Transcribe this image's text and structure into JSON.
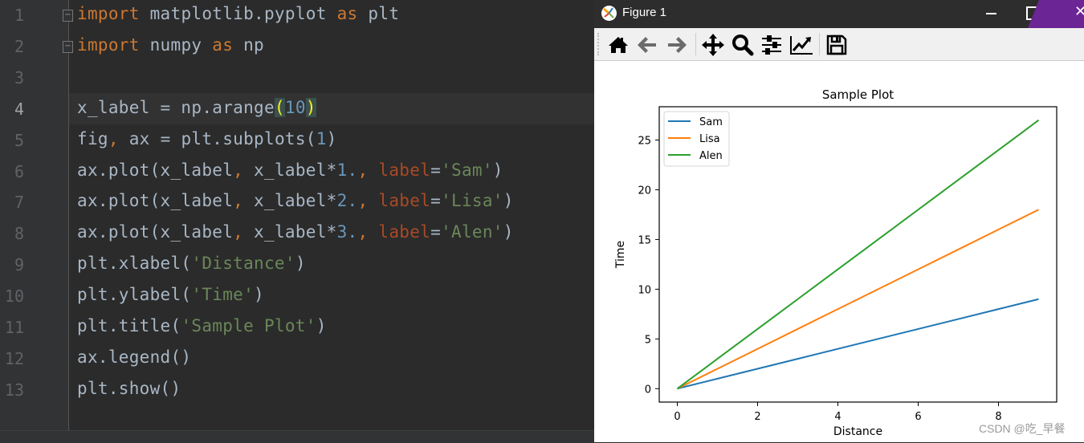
{
  "editor": {
    "lines": [
      {
        "num": "1",
        "tokens": [
          [
            "kw",
            "import"
          ],
          [
            "t",
            " matplotlib.pyplot "
          ],
          [
            "kw",
            "as"
          ],
          [
            "t",
            " plt"
          ]
        ]
      },
      {
        "num": "2",
        "tokens": [
          [
            "kw",
            "import"
          ],
          [
            "t",
            " numpy "
          ],
          [
            "kw",
            "as"
          ],
          [
            "t",
            " np"
          ]
        ]
      },
      {
        "num": "3",
        "tokens": []
      },
      {
        "num": "4",
        "tokens": [
          [
            "t",
            "x_label = np.arange"
          ],
          [
            "brk",
            "("
          ],
          [
            "num",
            "10"
          ],
          [
            "brk",
            ")"
          ]
        ]
      },
      {
        "num": "5",
        "tokens": [
          [
            "t",
            "fig"
          ],
          [
            "com",
            ","
          ],
          [
            "t",
            " ax = plt.subplots("
          ],
          [
            "num",
            "1"
          ],
          [
            "t",
            ")"
          ]
        ]
      },
      {
        "num": "6",
        "tokens": [
          [
            "t",
            "ax.plot(x_label"
          ],
          [
            "com",
            ","
          ],
          [
            "t",
            " x_label*"
          ],
          [
            "num",
            "1."
          ],
          [
            "com",
            ","
          ],
          [
            "t",
            " "
          ],
          [
            "par",
            "label"
          ],
          [
            "t",
            "="
          ],
          [
            "str",
            "'Sam'"
          ],
          [
            "t",
            ")"
          ]
        ]
      },
      {
        "num": "7",
        "tokens": [
          [
            "t",
            "ax.plot(x_label"
          ],
          [
            "com",
            ","
          ],
          [
            "t",
            " x_label*"
          ],
          [
            "num",
            "2."
          ],
          [
            "com",
            ","
          ],
          [
            "t",
            " "
          ],
          [
            "par",
            "label"
          ],
          [
            "t",
            "="
          ],
          [
            "str",
            "'Lisa'"
          ],
          [
            "t",
            ")"
          ]
        ]
      },
      {
        "num": "8",
        "tokens": [
          [
            "t",
            "ax.plot(x_label"
          ],
          [
            "com",
            ","
          ],
          [
            "t",
            " x_label*"
          ],
          [
            "num",
            "3."
          ],
          [
            "com",
            ","
          ],
          [
            "t",
            " "
          ],
          [
            "par",
            "label"
          ],
          [
            "t",
            "="
          ],
          [
            "str",
            "'Alen'"
          ],
          [
            "t",
            ")"
          ]
        ]
      },
      {
        "num": "9",
        "tokens": [
          [
            "t",
            "plt.xlabel("
          ],
          [
            "str",
            "'Distance'"
          ],
          [
            "t",
            ")"
          ]
        ]
      },
      {
        "num": "10",
        "tokens": [
          [
            "t",
            "plt.ylabel("
          ],
          [
            "str",
            "'Time'"
          ],
          [
            "t",
            ")"
          ]
        ]
      },
      {
        "num": "11",
        "tokens": [
          [
            "t",
            "plt.title("
          ],
          [
            "str",
            "'Sample Plot'"
          ],
          [
            "t",
            ")"
          ]
        ]
      },
      {
        "num": "12",
        "tokens": [
          [
            "t",
            "ax.legend()"
          ]
        ]
      },
      {
        "num": "13",
        "tokens": [
          [
            "t",
            "plt.show()"
          ]
        ]
      }
    ],
    "current_line": "4"
  },
  "figure_window": {
    "title": "Figure 1",
    "toolbar": [
      "home-icon",
      "back-icon",
      "forward-icon",
      "pan-icon",
      "zoom-icon",
      "configure-subplots-icon",
      "edit-axis-icon",
      "save-icon"
    ],
    "close_glyph": "✕"
  },
  "watermark": "CSDN @吃_早餐",
  "chart_data": {
    "type": "line",
    "title": "Sample Plot",
    "xlabel": "Distance",
    "ylabel": "Time",
    "x": [
      0,
      1,
      2,
      3,
      4,
      5,
      6,
      7,
      8,
      9
    ],
    "series": [
      {
        "name": "Sam",
        "color": "#1f77b4",
        "values": [
          0,
          1,
          2,
          3,
          4,
          5,
          6,
          7,
          8,
          9
        ]
      },
      {
        "name": "Lisa",
        "color": "#ff7f0e",
        "values": [
          0,
          2,
          4,
          6,
          8,
          10,
          12,
          14,
          16,
          18
        ]
      },
      {
        "name": "Alen",
        "color": "#2ca02c",
        "values": [
          0,
          3,
          6,
          9,
          12,
          15,
          18,
          21,
          24,
          27
        ]
      }
    ],
    "xlim": [
      -0.45,
      9.45
    ],
    "ylim": [
      -1.35,
      28.35
    ],
    "xticks": [
      0,
      2,
      4,
      6,
      8
    ],
    "yticks": [
      0,
      5,
      10,
      15,
      20,
      25
    ],
    "legend": "upper-left",
    "grid": false
  }
}
